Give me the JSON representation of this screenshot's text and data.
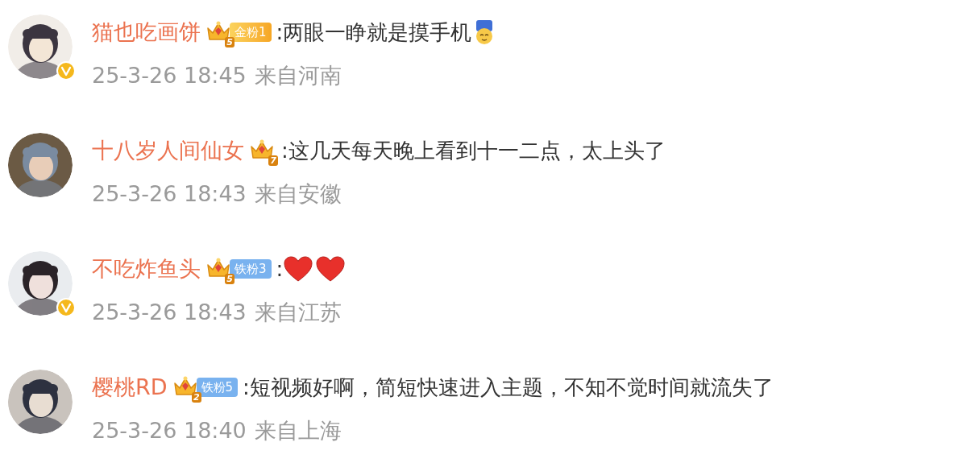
{
  "comments": [
    {
      "name": "猫也吃画饼",
      "verified": true,
      "crown_level": "5",
      "fan_badge": {
        "kind": "gold",
        "label": "金粉1"
      },
      "text": ":两眼一睁就是摸手机",
      "emojis": [
        {
          "kind": "face"
        }
      ],
      "time": "25-3-26 18:45",
      "location": "来自河南"
    },
    {
      "name": "十八岁人间仙女",
      "verified": false,
      "crown_level": "7",
      "text": ":这几天每天晚上看到十一二点，太上头了",
      "time": "25-3-26 18:43",
      "location": "来自安徽"
    },
    {
      "name": "不吃炸鱼头",
      "verified": true,
      "crown_level": "5",
      "fan_badge": {
        "kind": "iron",
        "label": "铁粉3"
      },
      "text": ":",
      "emojis": [
        {
          "kind": "heart"
        },
        {
          "kind": "heart"
        }
      ],
      "time": "25-3-26 18:43",
      "location": "来自江苏"
    },
    {
      "name": "樱桃RD",
      "verified": false,
      "crown_level": "2",
      "fan_badge": {
        "kind": "iron",
        "label": "铁粉5"
      },
      "text": ":短视频好啊，简短快速进入主题，不知不觉时间就流失了",
      "time": "25-3-26 18:40",
      "location": "来自上海"
    }
  ]
}
